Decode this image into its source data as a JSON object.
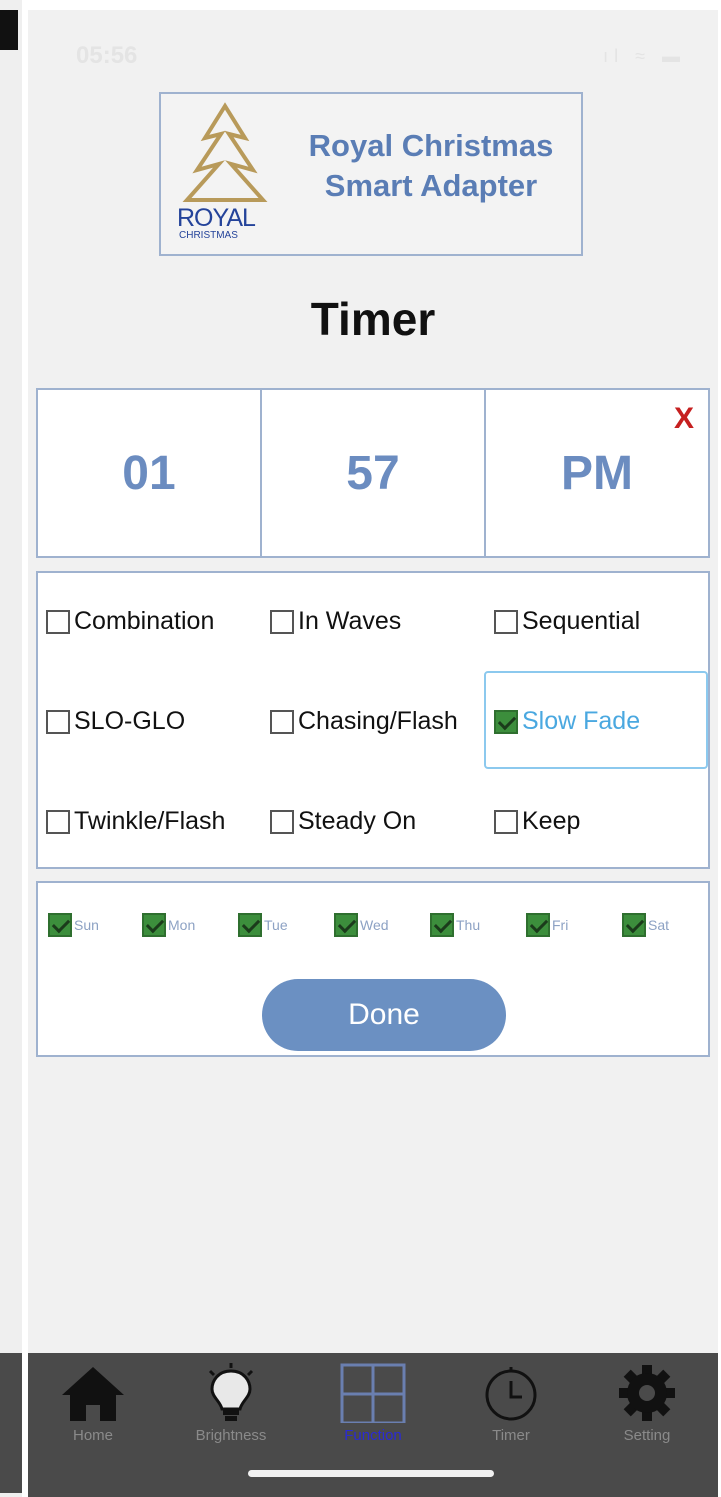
{
  "status_bar": {
    "time": "05:56",
    "icons": "ıl ≈ ▬"
  },
  "logo": {
    "brand": "ROYAL",
    "brand_sub": "CHRISTMAS",
    "title_line1": "Royal Christmas",
    "title_line2": "Smart Adapter"
  },
  "page_title": "Timer",
  "time": {
    "hour": "01",
    "minute": "57",
    "period": "PM",
    "close_label": "X"
  },
  "modes": [
    {
      "label": "Combination",
      "checked": false
    },
    {
      "label": "In Waves",
      "checked": false
    },
    {
      "label": "Sequential",
      "checked": false
    },
    {
      "label": "SLO-GLO",
      "checked": false
    },
    {
      "label": "Chasing/Flash",
      "checked": false
    },
    {
      "label": "Slow Fade",
      "checked": true
    },
    {
      "label": "Twinkle/Flash",
      "checked": false
    },
    {
      "label": "Steady On",
      "checked": false
    },
    {
      "label": "Keep",
      "checked": false
    }
  ],
  "days": [
    {
      "label": "Sun",
      "checked": true
    },
    {
      "label": "Mon",
      "checked": true
    },
    {
      "label": "Tue",
      "checked": true
    },
    {
      "label": "Wed",
      "checked": true
    },
    {
      "label": "Thu",
      "checked": true
    },
    {
      "label": "Fri",
      "checked": true
    },
    {
      "label": "Sat",
      "checked": true
    }
  ],
  "done_label": "Done",
  "tabs": [
    {
      "label": "Home",
      "icon": "home-icon",
      "active": false
    },
    {
      "label": "Brightness",
      "icon": "lightbulb-icon",
      "active": false
    },
    {
      "label": "Function",
      "icon": "grid-icon",
      "active": true
    },
    {
      "label": "Timer",
      "icon": "clock-icon",
      "active": false
    },
    {
      "label": "Setting",
      "icon": "gear-icon",
      "active": false
    }
  ],
  "colors": {
    "accent": "#6b90c2",
    "check": "#3c8e3c",
    "close": "#c62020",
    "tab_active": "#2a2ad4"
  }
}
